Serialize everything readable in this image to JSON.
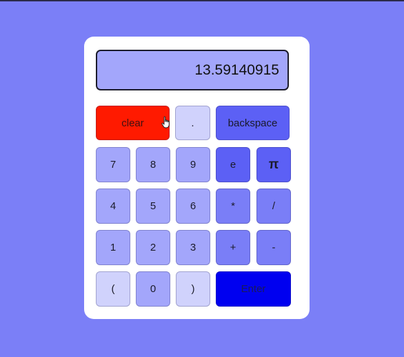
{
  "display": {
    "value": "13.59140915"
  },
  "keys": {
    "clear": "clear",
    "dot": ".",
    "backspace": "backspace",
    "seven": "7",
    "eight": "8",
    "nine": "9",
    "e": "e",
    "pi": "π",
    "four": "4",
    "five": "5",
    "six": "6",
    "multiply": "*",
    "divide": "/",
    "one": "1",
    "two": "2",
    "three": "3",
    "plus": "+",
    "minus": "-",
    "open_paren": "(",
    "zero": "0",
    "close_paren": ")",
    "enter": "Enter"
  },
  "colors": {
    "background": "#7b7ff7",
    "panel": "#ffffff",
    "display": "#a3a6fb",
    "clear": "#ff1a00",
    "enter": "#0000f0"
  }
}
